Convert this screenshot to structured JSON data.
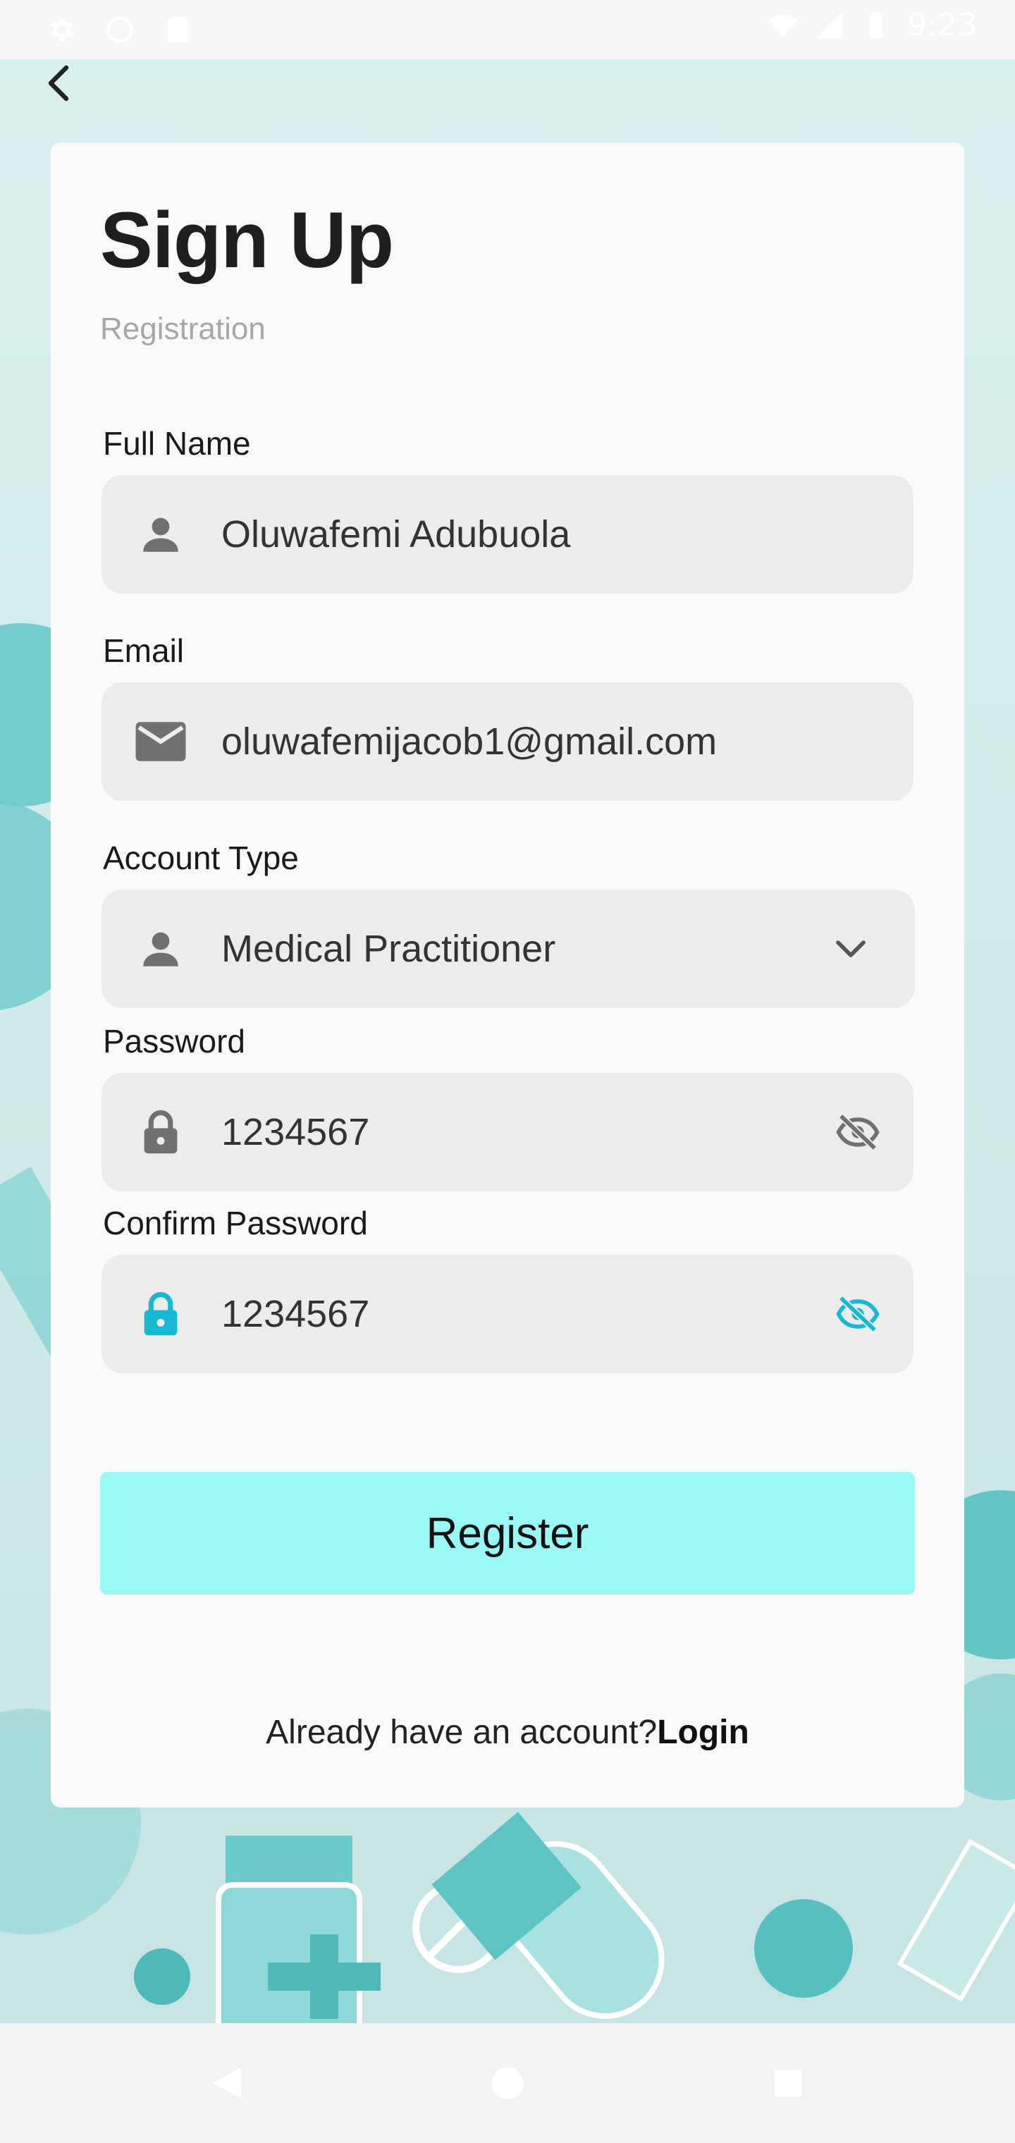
{
  "status_bar": {
    "time": "9:23",
    "icons": [
      "settings-icon",
      "circle-icon",
      "sd-card-icon",
      "wifi-icon",
      "signal-icon",
      "battery-icon"
    ]
  },
  "nav": {
    "back_icon": "chevron-left-icon"
  },
  "card": {
    "title": "Sign Up",
    "subtitle": "Registration"
  },
  "form": {
    "full_name": {
      "label": "Full Name",
      "value": "Oluwafemi Adubuola",
      "icon": "person-icon"
    },
    "email": {
      "label": "Email",
      "value": "oluwafemijacob1@gmail.com",
      "icon": "mail-icon"
    },
    "account_type": {
      "label": "Account Type",
      "value": "Medical Practitioner",
      "icon": "person-icon",
      "trail_icon": "chevron-down-icon"
    },
    "password": {
      "label": "Password",
      "value": "1234567",
      "icon": "lock-icon",
      "trail_icon": "eye-off-icon"
    },
    "confirm_password": {
      "label": "Confirm Password",
      "value": "1234567",
      "icon": "lock-icon",
      "trail_icon": "eye-off-icon"
    }
  },
  "actions": {
    "register_label": "Register",
    "login_prompt": "Already have an account?",
    "login_label": "Login"
  },
  "colors": {
    "accent_button": "#9af8f3",
    "active_icon": "#17b8d4",
    "field_bg": "#ececec",
    "inactive_icon": "#707070"
  },
  "system_nav": [
    "back-triangle-icon",
    "home-circle-icon",
    "recents-square-icon"
  ]
}
